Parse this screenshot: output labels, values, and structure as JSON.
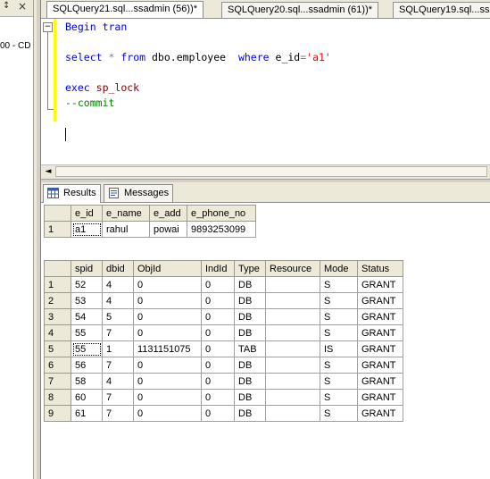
{
  "left_panel": {
    "pin_glyph": "↕",
    "close_glyph": "×",
    "truncated_text": "00 - CD"
  },
  "tabs": [
    {
      "label": "SQLQuery21.sql...ssadmin (56))*",
      "active": true
    },
    {
      "label": "SQLQuery20.sql...ssadmin (61))*",
      "active": false
    },
    {
      "label": "SQLQuery19.sql...ss",
      "active": false
    }
  ],
  "editor": {
    "fold_glyph": "−",
    "line1": {
      "kw1": "Begin",
      "kw2": "tran"
    },
    "line2": {
      "select": "select",
      "star": "*",
      "from": "from",
      "table": "dbo.employee",
      "where": "where",
      "col": "e_id",
      "eq": "=",
      "val": "'a1'"
    },
    "line3": {
      "exec": "exec",
      "proc": "sp_lock"
    },
    "line4": {
      "comment": "--commit"
    }
  },
  "scroll": {
    "left_arrow": "◄"
  },
  "result_tabs": {
    "results": "Results",
    "messages": "Messages"
  },
  "grid1": {
    "columns": [
      "e_id",
      "e_name",
      "e_add",
      "e_phone_no"
    ],
    "rows": [
      {
        "n": "1",
        "cells": [
          "a1",
          "rahul",
          "powai",
          "9893253099"
        ]
      }
    ]
  },
  "grid2": {
    "columns": [
      "spid",
      "dbid",
      "ObjId",
      "IndId",
      "Type",
      "Resource",
      "Mode",
      "Status"
    ],
    "rows": [
      {
        "n": "1",
        "cells": [
          "52",
          "4",
          "0",
          "0",
          "DB",
          "",
          "S",
          "GRANT"
        ]
      },
      {
        "n": "2",
        "cells": [
          "53",
          "4",
          "0",
          "0",
          "DB",
          "",
          "S",
          "GRANT"
        ]
      },
      {
        "n": "3",
        "cells": [
          "54",
          "5",
          "0",
          "0",
          "DB",
          "",
          "S",
          "GRANT"
        ]
      },
      {
        "n": "4",
        "cells": [
          "55",
          "7",
          "0",
          "0",
          "DB",
          "",
          "S",
          "GRANT"
        ]
      },
      {
        "n": "5",
        "cells": [
          "55",
          "1",
          "1131151075",
          "0",
          "TAB",
          "",
          "IS",
          "GRANT"
        ]
      },
      {
        "n": "6",
        "cells": [
          "56",
          "7",
          "0",
          "0",
          "DB",
          "",
          "S",
          "GRANT"
        ]
      },
      {
        "n": "7",
        "cells": [
          "58",
          "4",
          "0",
          "0",
          "DB",
          "",
          "S",
          "GRANT"
        ]
      },
      {
        "n": "8",
        "cells": [
          "60",
          "7",
          "0",
          "0",
          "DB",
          "",
          "S",
          "GRANT"
        ]
      },
      {
        "n": "9",
        "cells": [
          "61",
          "7",
          "0",
          "0",
          "DB",
          "",
          "S",
          "GRANT"
        ]
      }
    ]
  }
}
